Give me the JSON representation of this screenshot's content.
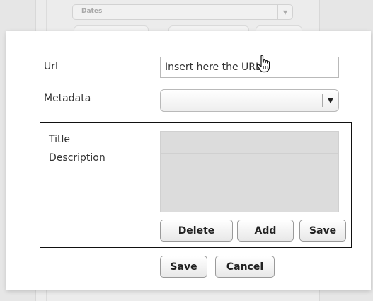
{
  "background": {
    "select_label": "Dates",
    "select_arrow_icon": "chevron-down-icon"
  },
  "dialog": {
    "url_label": "Url",
    "url_input_value": "Insert here the URL",
    "metadata_label": "Metadata",
    "metadata_selected": "",
    "metadata_arrow_icon": "chevron-down-icon",
    "metadata_panel": {
      "title_label": "Title",
      "description_label": "Description",
      "title_value": "",
      "description_value": "",
      "delete_label": "Delete",
      "add_label": "Add",
      "save_label": "Save"
    },
    "save_label": "Save",
    "cancel_label": "Cancel"
  },
  "cursor_icon": "hand-pointer-icon"
}
